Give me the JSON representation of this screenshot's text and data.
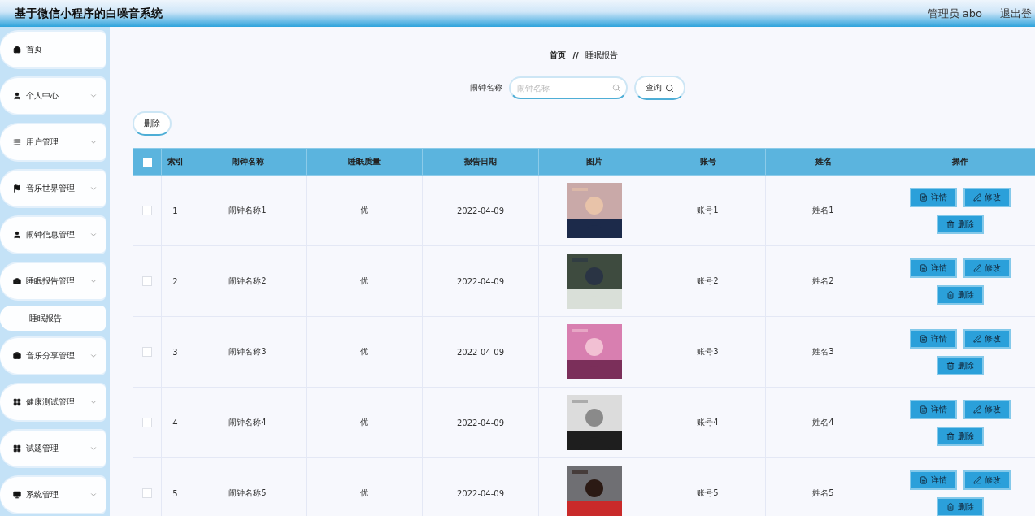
{
  "header": {
    "title": "基于微信小程序的白噪音系统",
    "user": "管理员 abo",
    "logout": "退出登"
  },
  "sidebar": {
    "items": [
      {
        "label": "首页",
        "kind": "link"
      },
      {
        "label": "个人中心",
        "kind": "menu"
      },
      {
        "label": "用户管理",
        "kind": "menu"
      },
      {
        "label": "音乐世界管理",
        "kind": "menu"
      },
      {
        "label": "闹钟信息管理",
        "kind": "menu"
      },
      {
        "label": "睡眠报告管理",
        "kind": "menu",
        "children": [
          {
            "label": "睡眠报告"
          }
        ]
      },
      {
        "label": "音乐分享管理",
        "kind": "menu"
      },
      {
        "label": "健康测试管理",
        "kind": "menu"
      },
      {
        "label": "试题管理",
        "kind": "menu"
      },
      {
        "label": "系统管理",
        "kind": "menu"
      }
    ]
  },
  "breadcrumb": [
    "首页",
    "//",
    "睡眠报告"
  ],
  "search": {
    "label": "闹钟名称",
    "placeholder": "闹钟名称",
    "button": "查询"
  },
  "toolbar": {
    "delete": "删除"
  },
  "table": {
    "select_all_checked": false,
    "columns": [
      "索引",
      "闹钟名称",
      "睡眠质量",
      "报告日期",
      "图片",
      "账号",
      "姓名",
      "操作"
    ],
    "rows": [
      {
        "checked": false,
        "cells": [
          "1",
          "闹钟名称1",
          "优",
          "2022-04-09"
        ],
        "image": {
          "kind": "picture"
        },
        "account": "账号1",
        "name": "姓名1",
        "actions": [
          "详情",
          "修改",
          "删除"
        ]
      },
      {
        "checked": false,
        "cells": [
          "2",
          "闹钟名称2",
          "优",
          "2022-04-09"
        ],
        "image": {
          "kind": "picture"
        },
        "account": "账号2",
        "name": "姓名2",
        "actions": [
          "详情",
          "修改",
          "删除"
        ]
      },
      {
        "checked": false,
        "cells": [
          "3",
          "闹钟名称3",
          "优",
          "2022-04-09"
        ],
        "image": {
          "kind": "picture"
        },
        "account": "账号3",
        "name": "姓名3",
        "actions": [
          "详情",
          "修改",
          "删除"
        ]
      },
      {
        "checked": false,
        "cells": [
          "4",
          "闹钟名称4",
          "优",
          "2022-04-09"
        ],
        "image": {
          "kind": "picture"
        },
        "account": "账号4",
        "name": "姓名4",
        "actions": [
          "详情",
          "修改",
          "删除"
        ]
      },
      {
        "checked": false,
        "cells": [
          "5",
          "闹钟名称5",
          "优",
          "2022-04-09"
        ],
        "image": {
          "kind": "picture"
        },
        "account": "账号5",
        "name": "姓名5",
        "actions": [
          "详情",
          "修改",
          "删除"
        ]
      }
    ]
  }
}
